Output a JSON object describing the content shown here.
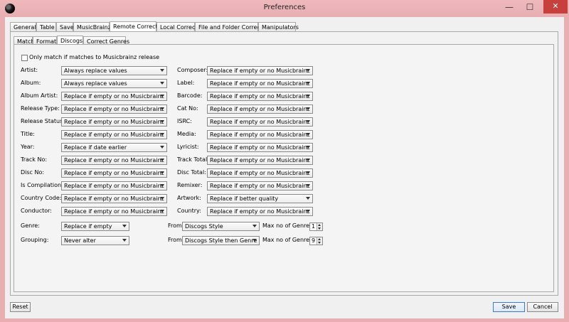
{
  "window": {
    "title": "Preferences",
    "close_glyph": "✕"
  },
  "tabs": [
    "General",
    "Table",
    "Save",
    "MusicBrainz",
    "Remote Correct",
    "Local Correct",
    "File and Folder Correct",
    "Manipulators"
  ],
  "subtabs": [
    "Match",
    "Format",
    "Discogs",
    "Correct Genres"
  ],
  "only_match": {
    "label": "Only match if matches to Musicbrainz release",
    "checked": false
  },
  "left_fields": [
    {
      "label": "Artist:",
      "value": "Always replace values"
    },
    {
      "label": "Album:",
      "value": "Always replace values"
    },
    {
      "label": "Album Artist:",
      "value": "Replace if empty or no Musicbrainz Id"
    },
    {
      "label": "Release Type:",
      "value": "Replace if empty or no Musicbrainz Id"
    },
    {
      "label": "Release Status:",
      "value": "Replace if empty or no Musicbrainz Id"
    },
    {
      "label": "Title:",
      "value": "Replace if empty or no Musicbrainz Id"
    },
    {
      "label": "Year:",
      "value": "Replace if date earlier"
    },
    {
      "label": "Track No:",
      "value": "Replace if empty or no Musicbrainz Id"
    },
    {
      "label": "Disc No:",
      "value": "Replace if empty or no Musicbrainz Id"
    },
    {
      "label": "Is Compilation:",
      "value": "Replace if empty or no Musicbrainz Id"
    },
    {
      "label": "Country Code:",
      "value": "Replace if empty or no Musicbrainz Id"
    },
    {
      "label": "Conductor:",
      "value": "Replace if empty or no Musicbrainz Id"
    }
  ],
  "right_fields": [
    {
      "label": "Composer:",
      "value": "Replace if empty or no Musicbrainz Id"
    },
    {
      "label": "Label:",
      "value": "Replace if empty or no Musicbrainz Id"
    },
    {
      "label": "Barcode:",
      "value": "Replace if empty or no Musicbrainz Id"
    },
    {
      "label": "Cat No:",
      "value": "Replace if empty or no Musicbrainz Id"
    },
    {
      "label": "ISRC:",
      "value": "Replace if empty or no Musicbrainz Id"
    },
    {
      "label": "Media:",
      "value": "Replace if empty or no Musicbrainz Id"
    },
    {
      "label": "Lyricist:",
      "value": "Replace if empty or no Musicbrainz Id"
    },
    {
      "label": "Track Total:",
      "value": "Replace if empty or no Musicbrainz Id"
    },
    {
      "label": "Disc Total:",
      "value": "Replace if empty or no Musicbrainz Id"
    },
    {
      "label": "Remixer:",
      "value": "Replace if empty or no Musicbrainz Id"
    },
    {
      "label": "Artwork:",
      "value": "Replace if better quality"
    },
    {
      "label": "Country:",
      "value": "Replace if empty or no Musicbrainz Id"
    }
  ],
  "genre": {
    "label": "Genre:",
    "value": "Replace if empty",
    "from_label": "From",
    "from_value": "Discogs Style",
    "max_label": "Max no of Genres",
    "max_value": "1"
  },
  "grouping": {
    "label": "Grouping:",
    "value": "Never alter",
    "from_label": "From",
    "from_value": "Discogs Style then Genre",
    "max_label": "Max no of Genres",
    "max_value": "9"
  },
  "buttons": {
    "reset": "Reset",
    "save": "Save",
    "cancel": "Cancel"
  }
}
